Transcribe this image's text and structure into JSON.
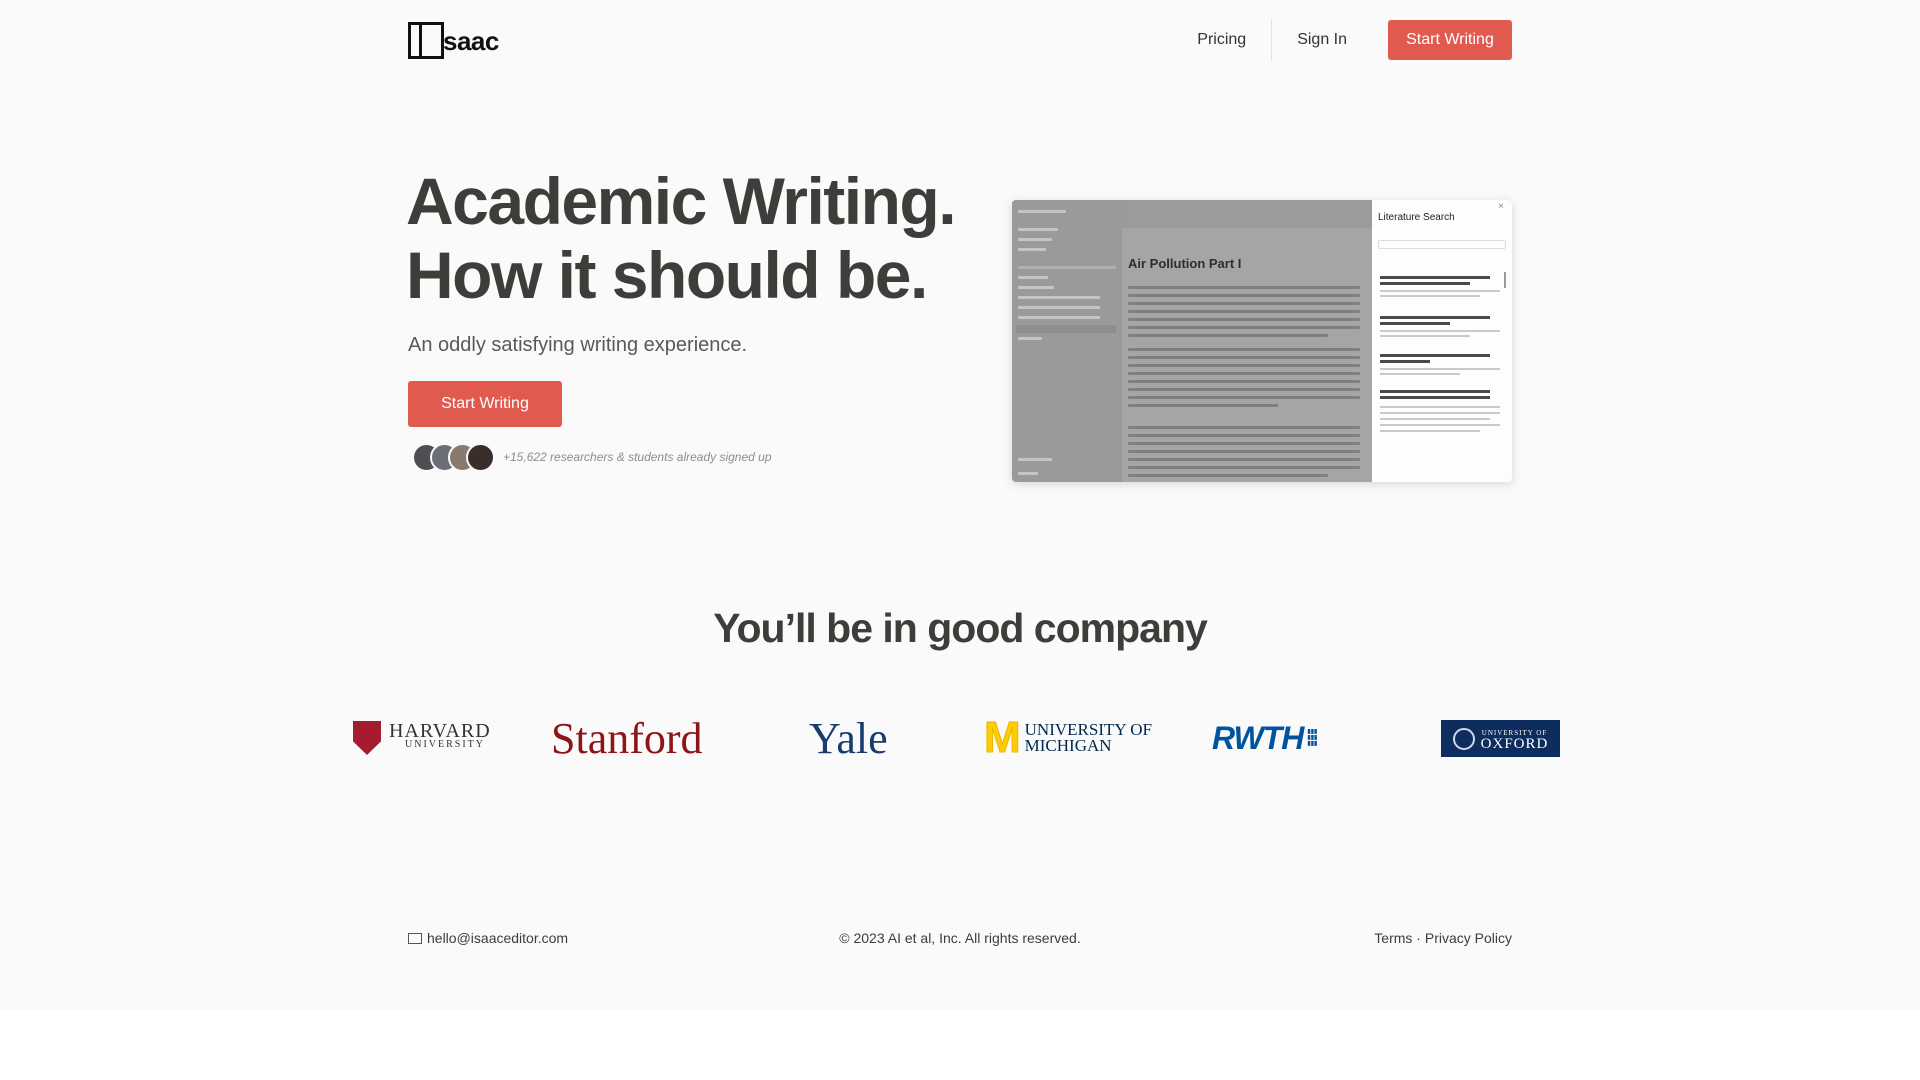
{
  "header": {
    "logo_text": "saac",
    "nav": {
      "pricing": "Pricing",
      "sign_in": "Sign In",
      "cta": "Start Writing"
    }
  },
  "hero": {
    "title_line1": "Academic Writing.",
    "title_line2": "How it should be.",
    "subtitle": "An oddly satisfying writing experience.",
    "cta": "Start Writing",
    "signup_text": "+15,622 researchers & students already signed up"
  },
  "screenshot": {
    "doc_title": "Air Pollution Part I",
    "panel_title": "Literature Search"
  },
  "company": {
    "title": "You’ll be in good company",
    "logos": {
      "harvard_main": "HARVARD",
      "harvard_sub": "UNIVERSITY",
      "stanford": "Stanford",
      "yale": "Yale",
      "michigan_line1": "UNIVERSITY OF",
      "michigan_line2": "MICHIGAN",
      "rwth": "RWTH",
      "oxford_line1": "UNIVERSITY OF",
      "oxford_line2": "OXFORD"
    }
  },
  "footer": {
    "email": "hello@isaaceditor.com",
    "copyright": "© 2023 AI et al, Inc. All rights reserved.",
    "terms": "Terms",
    "separator": "·",
    "privacy": "Privacy Policy"
  },
  "colors": {
    "accent": "#e05a4f",
    "text": "#3f3d3a",
    "background": "#fafafa"
  },
  "icons": {
    "email": "mail-icon"
  }
}
